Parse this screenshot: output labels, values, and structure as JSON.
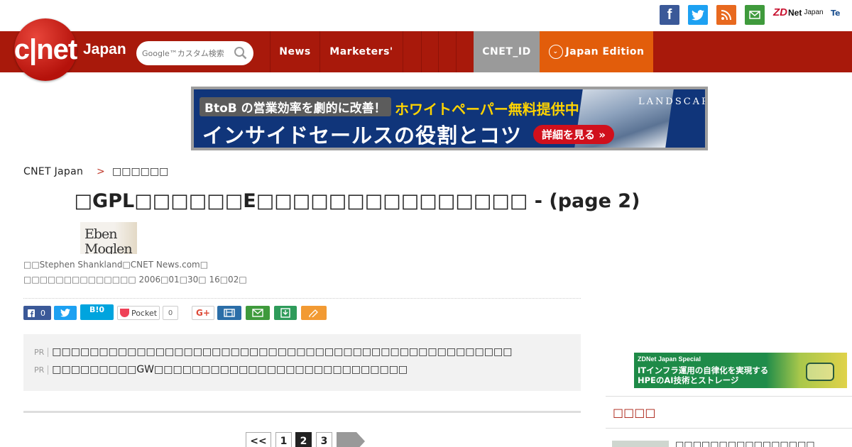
{
  "social": {
    "facebook_glyph": "f",
    "zdnet_mark": "ZD",
    "zdnet_net": "Net",
    "zdnet_japan": "Japan",
    "te_glyph": "Te"
  },
  "header": {
    "logo_text": "c|net",
    "logo_sub": "Japan",
    "search_placeholder": "Google™カスタム検索",
    "nav": {
      "news": "News",
      "marketers": "Marketers'",
      "cnet_id": "CNET_ID",
      "edition": "Japan Edition",
      "edition_glyph": "⌄"
    }
  },
  "banner": {
    "tag": "BtoB の営業効率を劇的に改善！",
    "highlight": "ホワイトペーパー無料提供中",
    "main": "インサイドセールスの役割とコツ",
    "button": "詳細を見る »",
    "brand": "LANDSCAPE"
  },
  "breadcrumb": {
    "home": "CNET Japan",
    "sep": ">",
    "category": "□□□□□□"
  },
  "article": {
    "title": "□GPL□□□□□□E□□□□□□□□□□□□□□□ - (page 2)",
    "author_photo_text": "Eben Moglen",
    "byline": "□□Stephen Shankland□CNET News.com□",
    "dateline": "□□□□□□□□□□□□□□   2006□01□30□ 16□02□"
  },
  "share": {
    "fb_count": "0",
    "hatena": "B!0",
    "pocket": "Pocket",
    "pocket_count": "0",
    "gplus": "G+"
  },
  "pr": {
    "tag": "PR",
    "items": [
      "□□□□□□□□□□□□□□□□□□□□□□□□□□□□□□□□□□□□□□□□□□□□□□□□□",
      "□□□□□□□□□GW□□□□□□□□□□□□□□□□□□□□□□□□□□□"
    ]
  },
  "pagination": {
    "first": "<<",
    "pages": [
      "1",
      "2",
      "3"
    ],
    "current": "2"
  },
  "sidebar": {
    "ad_label": "ZDNet Japan Special",
    "ad_line1": "ITインフラ運用の自律化を実現する",
    "ad_line2": "HPEのAI技術とストレージ",
    "heading": "□□□□",
    "item": "□□□□□□□□□□□□□□□□"
  }
}
